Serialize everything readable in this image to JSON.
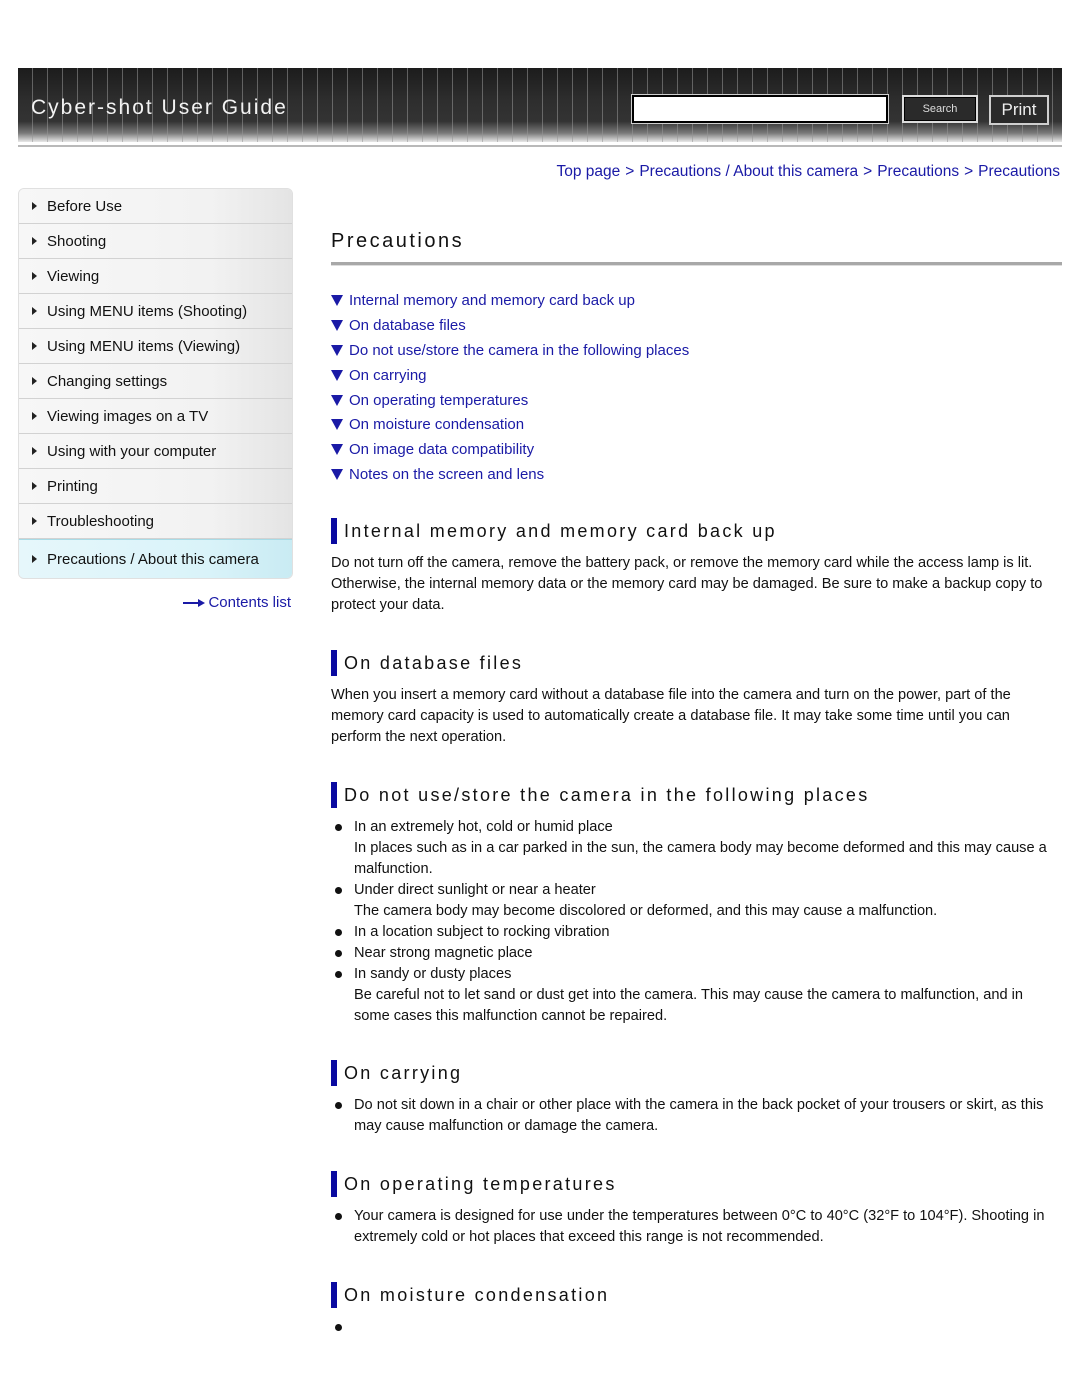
{
  "header": {
    "title": "Cyber-shot User Guide",
    "search": {
      "value": "",
      "placeholder": ""
    },
    "search_label": "Search",
    "print_label": "Print"
  },
  "breadcrumb": [
    {
      "label": "Top page"
    },
    {
      "label": "Precautions / About this camera"
    },
    {
      "label": "Precautions"
    },
    {
      "label": "Precautions"
    }
  ],
  "breadcrumb_separator": ">",
  "sidebar": {
    "items": [
      {
        "label": "Before Use"
      },
      {
        "label": "Shooting"
      },
      {
        "label": "Viewing"
      },
      {
        "label": "Using MENU items (Shooting)"
      },
      {
        "label": "Using MENU items (Viewing)"
      },
      {
        "label": "Changing settings"
      },
      {
        "label": "Viewing images on a TV"
      },
      {
        "label": "Using with your computer"
      },
      {
        "label": "Printing"
      },
      {
        "label": "Troubleshooting"
      },
      {
        "label": "Precautions / About this camera",
        "active": true
      }
    ],
    "contents_link": "Contents list"
  },
  "main": {
    "title": "Precautions",
    "toc": [
      "Internal memory and memory card back up",
      "On database files",
      "Do not use/store the camera in the following places",
      "On carrying",
      "On operating temperatures",
      "On moisture condensation",
      "On image data compatibility",
      "Notes on the screen and lens"
    ],
    "sections": {
      "internal_memory": {
        "title": "Internal memory and memory card back up",
        "body": "Do not turn off the camera, remove the battery pack, or remove the memory card while the access lamp is lit. Otherwise, the internal memory data or the memory card may be damaged. Be sure to make a backup copy to protect your data."
      },
      "database": {
        "title": "On database files",
        "body": "When you insert a memory card without a database file into the camera and turn on the power, part of the memory card capacity is used to automatically create a database file. It may take some time until you can perform the next operation."
      },
      "places": {
        "title": "Do not use/store the camera in the following places",
        "bullets": [
          {
            "text": "In an extremely hot, cold or humid place",
            "detail": "In places such as in a car parked in the sun, the camera body may become deformed and this may cause a malfunction."
          },
          {
            "text": "Under direct sunlight or near a heater",
            "detail": "The camera body may become discolored or deformed, and this may cause a malfunction."
          },
          {
            "text": "In a location subject to rocking vibration",
            "detail": ""
          },
          {
            "text": "Near strong magnetic place",
            "detail": ""
          },
          {
            "text": "In sandy or dusty places",
            "detail": "Be careful not to let sand or dust get into the camera. This may cause the camera to malfunction, and in some cases this malfunction cannot be repaired."
          }
        ]
      },
      "carrying": {
        "title": "On carrying",
        "bullets": [
          "Do not sit down in a chair or other place with the camera in the back pocket of your trousers or skirt, as this may cause malfunction or damage the camera."
        ]
      },
      "temperatures": {
        "title": "On operating temperatures",
        "bullets": [
          "Your camera is designed for use under the temperatures between 0°C to 40°C (32°F to 104°F). Shooting in extremely cold or hot places that exceed this range is not recommended."
        ]
      },
      "moisture": {
        "title": "On moisture condensation",
        "bullets": [
          ""
        ]
      }
    }
  },
  "colors": {
    "link": "#1a1aa6",
    "section_bar": "#0a0aa0",
    "active_nav": "#d9f3f9"
  }
}
